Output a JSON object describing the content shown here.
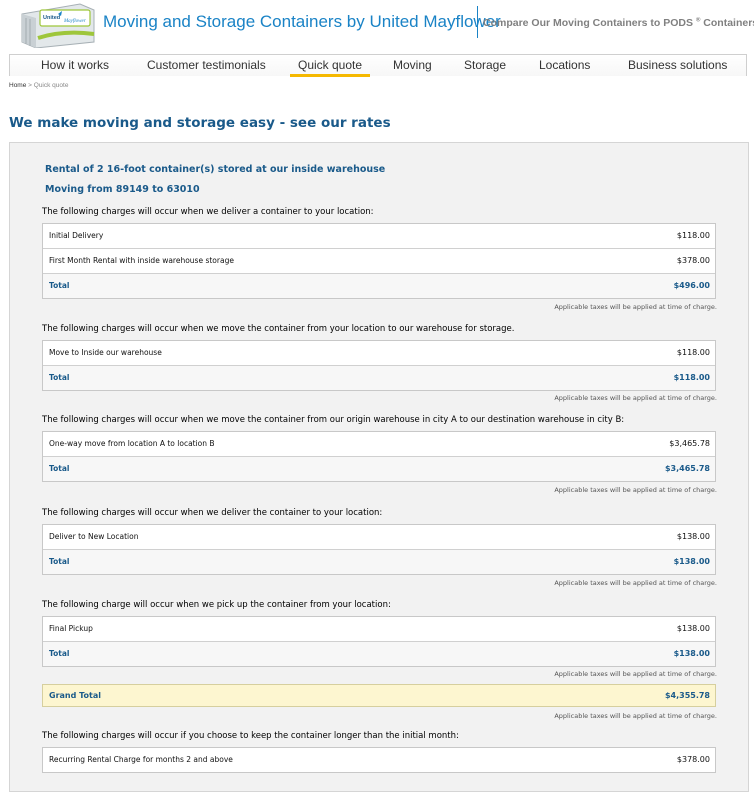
{
  "header": {
    "logo_text": "United Mayflower",
    "site_title": "Moving and Storage Containers by United Mayflower",
    "compare_link": "Compare Our Moving Containers to PODS",
    "compare_sup": "®",
    "compare_tail": " Containers"
  },
  "nav": {
    "items": [
      {
        "label": "How it works"
      },
      {
        "label": "Customer testimonials"
      },
      {
        "label": "Quick quote"
      },
      {
        "label": "Moving"
      },
      {
        "label": "Storage"
      },
      {
        "label": "Locations"
      },
      {
        "label": "Business solutions"
      }
    ],
    "active": "Quick quote",
    "accent_color": "#f5b800"
  },
  "breadcrumb": {
    "home": "Home",
    "separator": " > ",
    "current": "Quick quote"
  },
  "page_heading": "We make moving and storage easy - see our rates",
  "quote": {
    "summary_line1": "Rental of 2 16-foot container(s) stored at our inside warehouse",
    "summary_line2": "Moving from 89149 to 63010",
    "tax_note": "Applicable taxes will be applied at time of charge.",
    "sections": [
      {
        "heading": "The following charges will occur when we deliver a container to your location:",
        "rows": [
          {
            "label": "Initial Delivery",
            "amount": "$118.00"
          },
          {
            "label": "First Month Rental with inside warehouse storage",
            "amount": "$378.00"
          }
        ],
        "total_label": "Total",
        "total": "$496.00"
      },
      {
        "heading": "The following charges will occur when we move the container from your location to our warehouse for storage.",
        "rows": [
          {
            "label": "Move to Inside our warehouse",
            "amount": "$118.00"
          }
        ],
        "total_label": "Total",
        "total": "$118.00"
      },
      {
        "heading": "The following charges will occur when we move the container from our origin warehouse in city A to our destination warehouse in city B:",
        "rows": [
          {
            "label": "One-way move from location A to location B",
            "amount": "$3,465.78"
          }
        ],
        "total_label": "Total",
        "total": "$3,465.78"
      },
      {
        "heading": "The following charges will occur when we deliver the container to your location:",
        "rows": [
          {
            "label": "Deliver to New Location",
            "amount": "$138.00"
          }
        ],
        "total_label": "Total",
        "total": "$138.00"
      },
      {
        "heading": "The following charge will occur when we pick up the container from your location:",
        "rows": [
          {
            "label": "Final Pickup",
            "amount": "$138.00"
          }
        ],
        "total_label": "Total",
        "total": "$138.00"
      }
    ],
    "grand_total_label": "Grand Total",
    "grand_total": "$4,355.78",
    "recurring": {
      "heading": "The following charges will occur if you choose to keep the container longer than the initial month:",
      "rows": [
        {
          "label": "Recurring Rental Charge for months 2 and above",
          "amount": "$378.00"
        }
      ]
    }
  },
  "colors": {
    "brand_blue": "#1a83c6",
    "heading_blue": "#1a5a8a",
    "grand_total_bg": "#fdf6d0",
    "panel_bg": "#f2f2f2"
  }
}
